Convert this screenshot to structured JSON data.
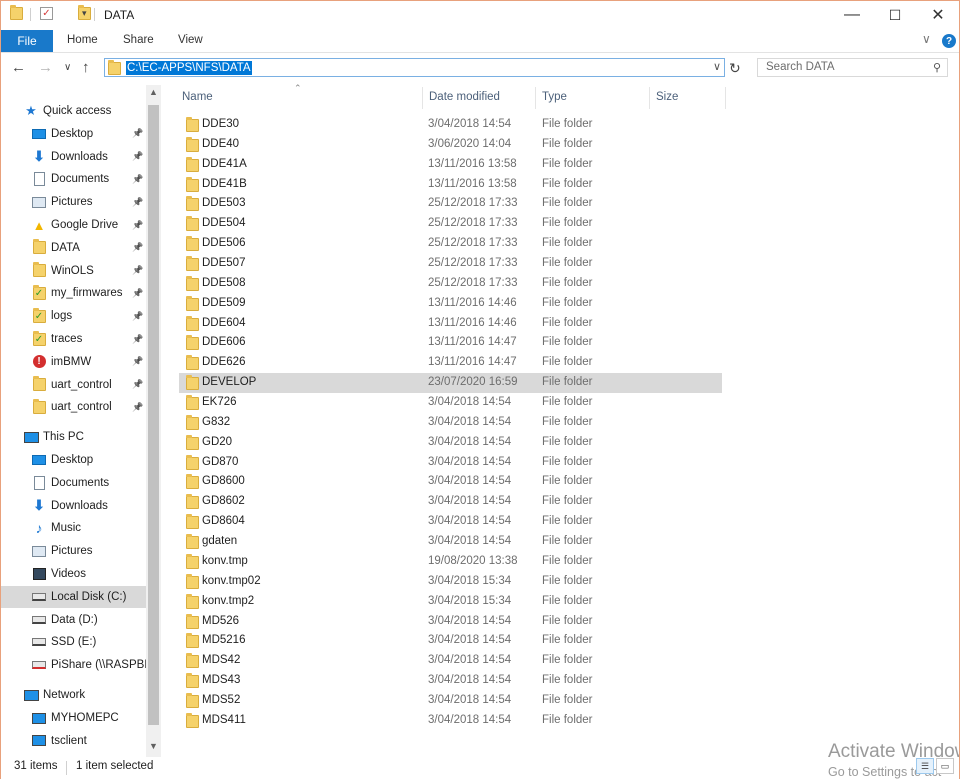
{
  "window": {
    "title": "DATA",
    "minimize": "—",
    "maximize": "☐",
    "close": "✕"
  },
  "ribbon": {
    "tabs": [
      "File",
      "Home",
      "Share",
      "View"
    ],
    "expand": "∨",
    "help": "?"
  },
  "nav": {
    "back": "←",
    "forward": "→",
    "recent": "∨",
    "up": "↑",
    "address": "C:\\EC-APPS\\NFS\\DATA",
    "address_dropdown": "∨",
    "refresh": "↻",
    "search_placeholder": "Search DATA",
    "search_icon": "⚲"
  },
  "sidebar": {
    "quick_access_label": "Quick access",
    "quick_access": [
      {
        "label": "Desktop",
        "icon": "desktop-icon"
      },
      {
        "label": "Downloads",
        "icon": "download-icon"
      },
      {
        "label": "Documents",
        "icon": "documents-icon"
      },
      {
        "label": "Pictures",
        "icon": "pictures-icon"
      },
      {
        "label": "Google Drive",
        "icon": "google-drive-icon"
      },
      {
        "label": "DATA",
        "icon": "folder-icon"
      },
      {
        "label": "WinOLS",
        "icon": "folder-icon"
      },
      {
        "label": "my_firmwares",
        "icon": "folder-check-icon"
      },
      {
        "label": "logs",
        "icon": "folder-check-icon"
      },
      {
        "label": "traces",
        "icon": "folder-check-icon"
      },
      {
        "label": "imBMW",
        "icon": "folder-error-icon"
      },
      {
        "label": "uart_control",
        "icon": "folder-icon"
      },
      {
        "label": "uart_control",
        "icon": "folder-icon"
      }
    ],
    "this_pc_label": "This PC",
    "this_pc": [
      {
        "label": "Desktop",
        "icon": "desktop-icon"
      },
      {
        "label": "Documents",
        "icon": "documents-icon"
      },
      {
        "label": "Downloads",
        "icon": "download-icon"
      },
      {
        "label": "Music",
        "icon": "music-icon"
      },
      {
        "label": "Pictures",
        "icon": "pictures-icon"
      },
      {
        "label": "Videos",
        "icon": "videos-icon"
      },
      {
        "label": "Local Disk (C:)",
        "icon": "drive-icon"
      },
      {
        "label": "Data (D:)",
        "icon": "drive-icon"
      },
      {
        "label": "SSD (E:)",
        "icon": "drive-icon"
      },
      {
        "label": "PiShare (\\\\RASPBER",
        "icon": "network-drive-icon"
      }
    ],
    "network_label": "Network",
    "network": [
      {
        "label": "MYHOMEPC",
        "icon": "computer-icon"
      },
      {
        "label": "tsclient",
        "icon": "computer-icon"
      }
    ]
  },
  "columns": [
    "Name",
    "Date modified",
    "Type",
    "Size"
  ],
  "files": [
    {
      "name": "DDE30",
      "date": "3/04/2018 14:54",
      "type": "File folder"
    },
    {
      "name": "DDE40",
      "date": "3/06/2020 14:04",
      "type": "File folder"
    },
    {
      "name": "DDE41A",
      "date": "13/11/2016 13:58",
      "type": "File folder"
    },
    {
      "name": "DDE41B",
      "date": "13/11/2016 13:58",
      "type": "File folder"
    },
    {
      "name": "DDE503",
      "date": "25/12/2018 17:33",
      "type": "File folder"
    },
    {
      "name": "DDE504",
      "date": "25/12/2018 17:33",
      "type": "File folder"
    },
    {
      "name": "DDE506",
      "date": "25/12/2018 17:33",
      "type": "File folder"
    },
    {
      "name": "DDE507",
      "date": "25/12/2018 17:33",
      "type": "File folder"
    },
    {
      "name": "DDE508",
      "date": "25/12/2018 17:33",
      "type": "File folder"
    },
    {
      "name": "DDE509",
      "date": "13/11/2016 14:46",
      "type": "File folder"
    },
    {
      "name": "DDE604",
      "date": "13/11/2016 14:46",
      "type": "File folder"
    },
    {
      "name": "DDE606",
      "date": "13/11/2016 14:47",
      "type": "File folder"
    },
    {
      "name": "DDE626",
      "date": "13/11/2016 14:47",
      "type": "File folder"
    },
    {
      "name": "DEVELOP",
      "date": "23/07/2020 16:59",
      "type": "File folder",
      "selected": true
    },
    {
      "name": "EK726",
      "date": "3/04/2018 14:54",
      "type": "File folder"
    },
    {
      "name": "G832",
      "date": "3/04/2018 14:54",
      "type": "File folder"
    },
    {
      "name": "GD20",
      "date": "3/04/2018 14:54",
      "type": "File folder"
    },
    {
      "name": "GD870",
      "date": "3/04/2018 14:54",
      "type": "File folder"
    },
    {
      "name": "GD8600",
      "date": "3/04/2018 14:54",
      "type": "File folder"
    },
    {
      "name": "GD8602",
      "date": "3/04/2018 14:54",
      "type": "File folder"
    },
    {
      "name": "GD8604",
      "date": "3/04/2018 14:54",
      "type": "File folder"
    },
    {
      "name": "gdaten",
      "date": "3/04/2018 14:54",
      "type": "File folder"
    },
    {
      "name": "konv.tmp",
      "date": "19/08/2020 13:38",
      "type": "File folder"
    },
    {
      "name": "konv.tmp02",
      "date": "3/04/2018 15:34",
      "type": "File folder"
    },
    {
      "name": "konv.tmp2",
      "date": "3/04/2018 15:34",
      "type": "File folder"
    },
    {
      "name": "MD526",
      "date": "3/04/2018 14:54",
      "type": "File folder"
    },
    {
      "name": "MD5216",
      "date": "3/04/2018 14:54",
      "type": "File folder"
    },
    {
      "name": "MDS42",
      "date": "3/04/2018 14:54",
      "type": "File folder"
    },
    {
      "name": "MDS43",
      "date": "3/04/2018 14:54",
      "type": "File folder"
    },
    {
      "name": "MDS52",
      "date": "3/04/2018 14:54",
      "type": "File folder"
    },
    {
      "name": "MDS411",
      "date": "3/04/2018 14:54",
      "type": "File folder"
    }
  ],
  "status": {
    "items": "31 items",
    "selected": "1 item selected"
  },
  "watermark": {
    "line1": "Activate Window",
    "line2": "Go to Settings to act"
  }
}
